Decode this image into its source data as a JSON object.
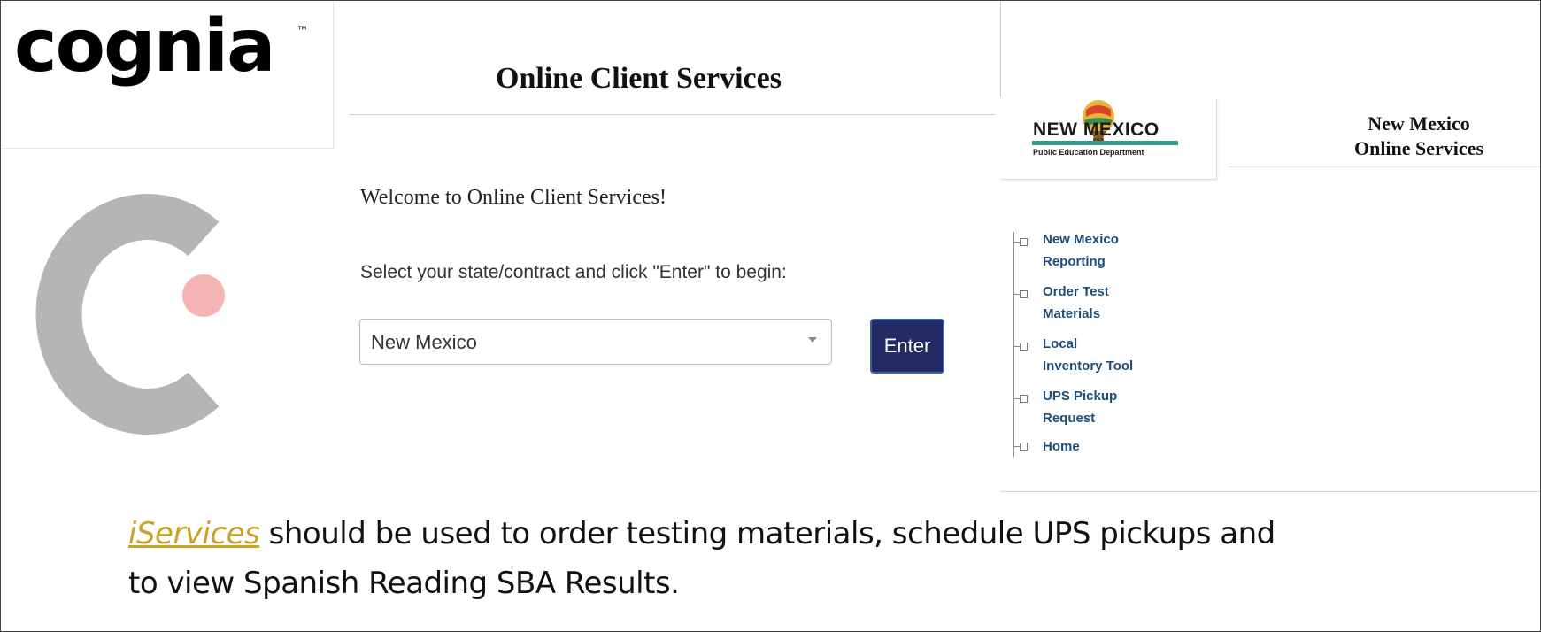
{
  "brand": {
    "logo_text": "cognia",
    "trademark": "™"
  },
  "client_services": {
    "title": "Online Client Services",
    "welcome": "Welcome to Online Client Services!",
    "prompt": "Select your state/contract and click \"Enter\" to begin:",
    "state_select_value": "New Mexico",
    "enter_label": "Enter"
  },
  "nm_panel": {
    "logo_word": "NEW MEXICO",
    "logo_sub": "Public Education Department",
    "title_line1": "New Mexico",
    "title_line2": "Online Services",
    "menu": [
      {
        "line1": "New Mexico",
        "line2": "Reporting"
      },
      {
        "line1": "Order Test",
        "line2": "Materials"
      },
      {
        "line1": "Local",
        "line2": "Inventory Tool"
      },
      {
        "line1": "UPS Pickup",
        "line2": "Request"
      },
      {
        "line1": "Home",
        "line2": ""
      }
    ]
  },
  "caption": {
    "link_text": "iServices",
    "text_line1": " should be used to order testing materials, schedule UPS pickups and",
    "text_line2": "to view Spanish Reading SBA Results."
  },
  "colors": {
    "enter_button": "#242a63",
    "menu_link": "#1f4e79",
    "caption_link": "#c9a227",
    "logo_dot": "#e03c3c",
    "c_mark": "#b5b5b5",
    "c_dot": "#f5b5b5"
  }
}
